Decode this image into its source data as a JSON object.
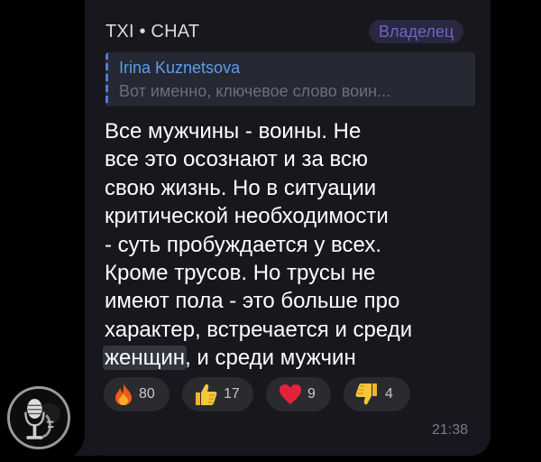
{
  "message": {
    "sender": "TXI • CHAT",
    "role_badge": "Владелец",
    "reply": {
      "author": "Irina Kuznetsova",
      "text": "Вот именно, ключевое слово воин..."
    },
    "lines": [
      "Все мужчины - воины. Не",
      "все это осознают и за всю",
      "свою жизнь. Но в ситуации",
      "критической необходимости",
      "- суть пробуждается у всех.",
      "Кроме трусов. Но трусы не",
      "имеют пола - это больше про",
      "характер, встречается и среди"
    ],
    "last_line": {
      "highlighted": "женщин",
      "rest": ", и среди мужчин"
    },
    "reactions": [
      {
        "icon": "fire-icon",
        "count": "80"
      },
      {
        "icon": "thumbs-up-icon",
        "count": "17"
      },
      {
        "icon": "heart-icon",
        "count": "9"
      },
      {
        "icon": "thumbs-down-icon",
        "count": "4"
      }
    ],
    "time": "21:38"
  },
  "colors": {
    "background": "#000000",
    "bubble": "#17171d",
    "accent_link": "#5e9cf0",
    "badge_text": "#6d65c4"
  }
}
